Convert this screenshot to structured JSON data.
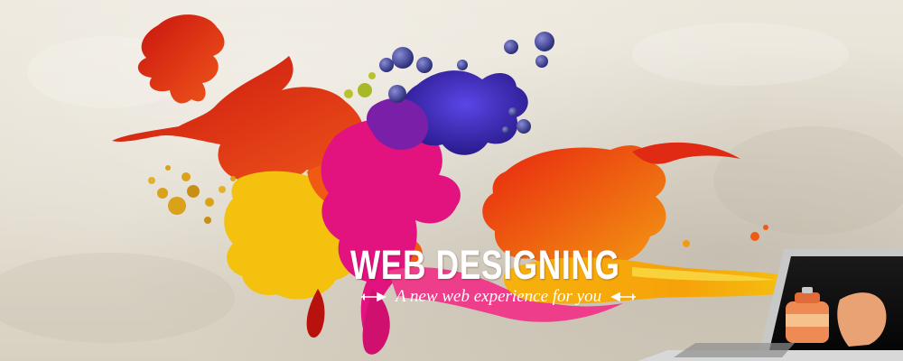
{
  "banner": {
    "headline": "WEB DESIGNING",
    "tagline": "A new web experience for you"
  },
  "icons": [
    "left-ornament-icon",
    "right-ornament-icon",
    "spray-can-icon"
  ],
  "colors": {
    "background": "#e6e0d4",
    "red": "#d9211c",
    "orange": "#f15a12",
    "yellow": "#f5c20f",
    "magenta": "#e4127e",
    "blue": "#3a25b8",
    "headline_text": "#ffffff"
  }
}
